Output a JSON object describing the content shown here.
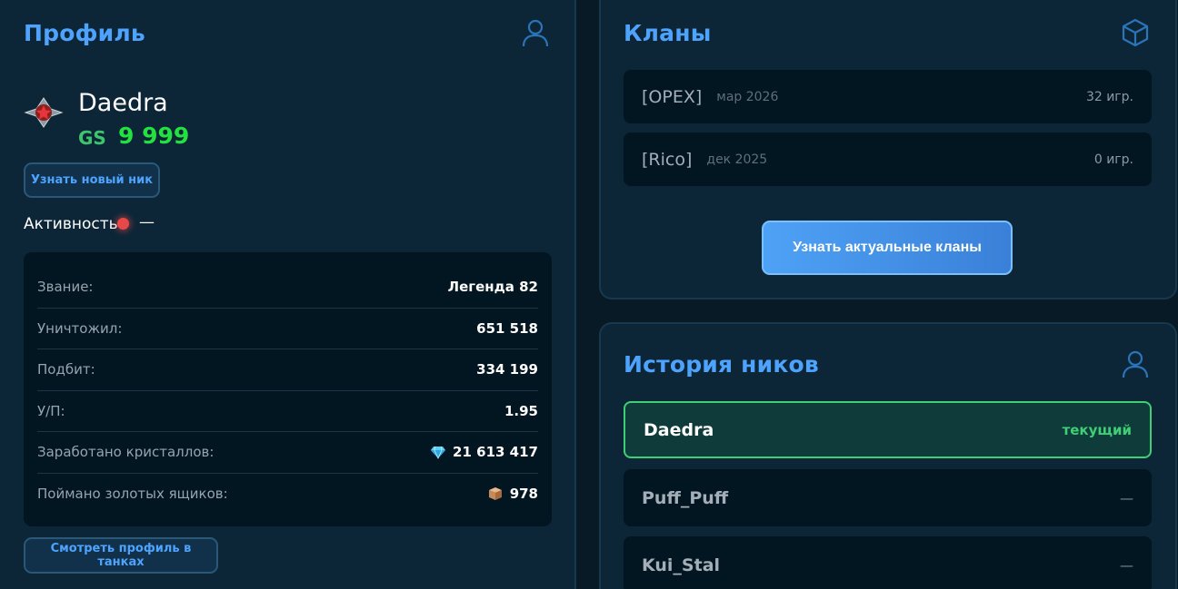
{
  "profile": {
    "title": "Профиль",
    "nickname": "Daedra",
    "gs_label": "GS",
    "gs_value": "9 999",
    "new_nick_button": "Узнать новый ник",
    "activity_label": "Активность",
    "activity_value": "—",
    "stats": [
      {
        "label": "Звание:",
        "value": "Легенда 82"
      },
      {
        "label": "Уничтожил:",
        "value": "651 518"
      },
      {
        "label": "Подбит:",
        "value": "334 199"
      },
      {
        "label": "У/П:",
        "value": "1.95"
      },
      {
        "label": "Заработано кристаллов:",
        "value": "21 613 417",
        "icon": "crystal-icon"
      },
      {
        "label": "Поймано золотых ящиков:",
        "value": "978",
        "icon": "gold-box-icon"
      }
    ],
    "tank_profile_button": "Смотреть профиль в танках"
  },
  "clans": {
    "title": "Кланы",
    "items": [
      {
        "tag": "[OPEX]",
        "date": "мар 2026",
        "games": "32 игр."
      },
      {
        "tag": "[Rico]",
        "date": "дек 2025",
        "games": "0 игр."
      }
    ],
    "actual_button": "Узнать актуальные кланы"
  },
  "nick_history": {
    "title": "История ников",
    "items": [
      {
        "name": "Daedra",
        "status": "текущий",
        "current": true
      },
      {
        "name": "Puff_Puff",
        "status": "—",
        "current": false
      },
      {
        "name": "Kui_Stal",
        "status": "—",
        "current": false
      }
    ]
  },
  "colors": {
    "background": "#071a26",
    "panel": "#0c2638",
    "accent_blue": "#4da3ff",
    "gs_green": "#23e23f",
    "current_green": "#3fcf74",
    "activity_red": "#e84848"
  },
  "icons": {
    "profile_header": "user-icon",
    "clans_header": "cube-icon",
    "history_header": "user-icon",
    "rank": "rank-star-icon"
  }
}
